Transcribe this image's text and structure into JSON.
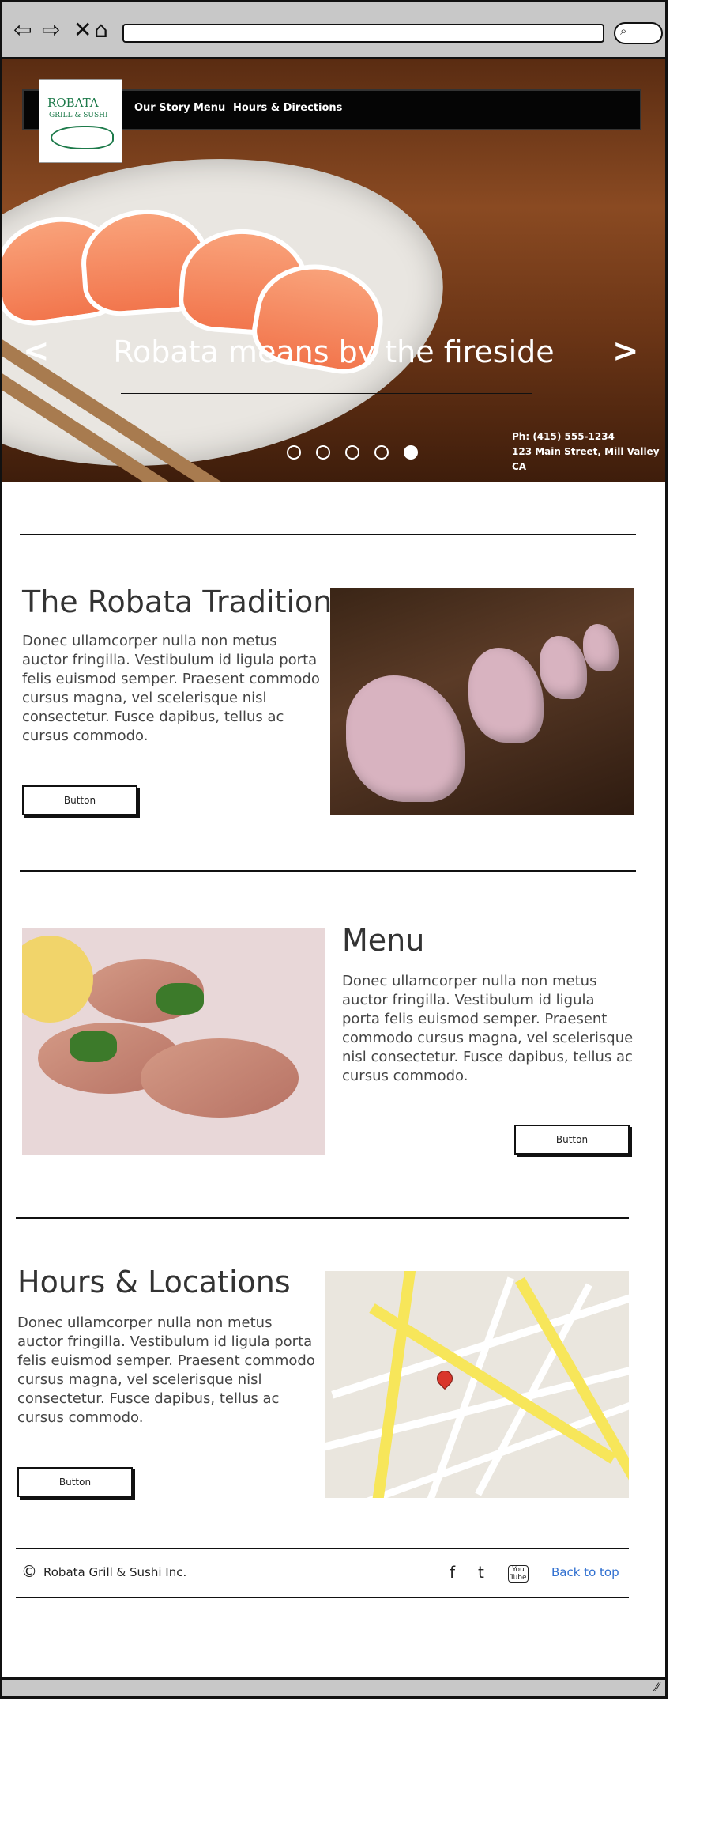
{
  "browser": {
    "back_icon": "back-arrow-icon",
    "forward_icon": "forward-arrow-icon",
    "stop_icon": "close-icon",
    "home_icon": "home-icon",
    "url": "",
    "search_icon": "search-icon"
  },
  "header": {
    "logo_line1": "ROBATA",
    "logo_line2": "GRILL & SUSHI",
    "nav": [
      "Our Story",
      "Menu",
      "Hours & Directions"
    ]
  },
  "hero": {
    "title": "Robata means by the fireside",
    "prev_icon": "chevron-left-icon",
    "next_icon": "chevron-right-icon",
    "slides": 5,
    "active_slide": 5,
    "phone": "Ph: (415) 555-1234",
    "address": "123 Main Street, Mill Valley CA"
  },
  "sections": [
    {
      "title": "The Robata Tradition",
      "body": "Donec ullamcorper nulla non metus auctor fringilla. Vestibulum id ligula porta felis euismod semper. Praesent commodo cursus magna, vel scelerisque nisl consectetur. Fusce dapibus, tellus ac cursus commodo.",
      "button": "Button"
    },
    {
      "title": "Menu",
      "body": "Donec ullamcorper nulla non metus auctor fringilla. Vestibulum id ligula porta felis euismod semper. Praesent commodo cursus magna, vel scelerisque nisl consectetur. Fusce dapibus, tellus ac cursus commodo.",
      "button": "Button"
    },
    {
      "title": "Hours & Locations",
      "body": "Donec ullamcorper nulla non metus auctor fringilla. Vestibulum id ligula porta felis euismod semper. Praesent commodo cursus magna, vel scelerisque nisl consectetur. Fusce dapibus, tellus ac cursus commodo.",
      "button": "Button"
    }
  ],
  "footer": {
    "copyright_symbol": "©",
    "company": "Robata Grill & Sushi Inc.",
    "social": [
      "facebook-icon",
      "twitter-icon",
      "youtube-icon"
    ],
    "facebook_glyph": "f",
    "twitter_glyph": "t",
    "youtube_glyph": "You Tube",
    "back_to_top": "Back to top"
  },
  "colors": {
    "link": "#2f6fd0",
    "logo_green": "#1d7a4a",
    "logo_red": "#c8102e",
    "chrome_gray": "#c8c8c8"
  }
}
